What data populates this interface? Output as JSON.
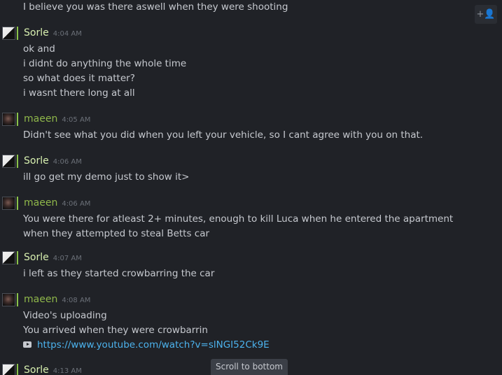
{
  "top_message": "I believe you was there aswell when they were shooting",
  "add_friend_icon": "add-user-icon",
  "groups": [
    {
      "author": "Sorle",
      "time": "4:04 AM",
      "lines": [
        "ok and",
        "i didnt do anything the whole time",
        "so what does it matter?",
        "i wasnt there long at all"
      ]
    },
    {
      "author": "maeen",
      "time": "4:05 AM",
      "lines": [
        "Didn't see what you did when you left your vehicle, so I cant agree with you on that."
      ]
    },
    {
      "author": "Sorle",
      "time": "4:06 AM",
      "lines": [
        "ill go get my demo just to show it>"
      ]
    },
    {
      "author": "maeen",
      "time": "4:06 AM",
      "lines": [
        "You were there for atleast 2+ minutes, enough to kill Luca when he entered the apartment when they attempted to steal Betts car"
      ]
    },
    {
      "author": "Sorle",
      "time": "4:07 AM",
      "lines": [
        "i left as they started crowbarring the car"
      ]
    },
    {
      "author": "maeen",
      "time": "4:08 AM",
      "lines": [
        "Video's uploading",
        "You arrived when they were crowbarrin"
      ],
      "link": "https://www.youtube.com/watch?v=slNGI52Ck9E",
      "link_icon": "youtube-icon"
    },
    {
      "author": "Sorle",
      "time": "4:13 AM",
      "lines": []
    }
  ],
  "scroll_to_bottom": "Scroll to bottom",
  "colors": {
    "background": "#202227",
    "sorle_name": "#d8f0b0",
    "maeen_name": "#8fb74a",
    "link": "#4cb3ee",
    "status_online": "#8bc34a"
  }
}
